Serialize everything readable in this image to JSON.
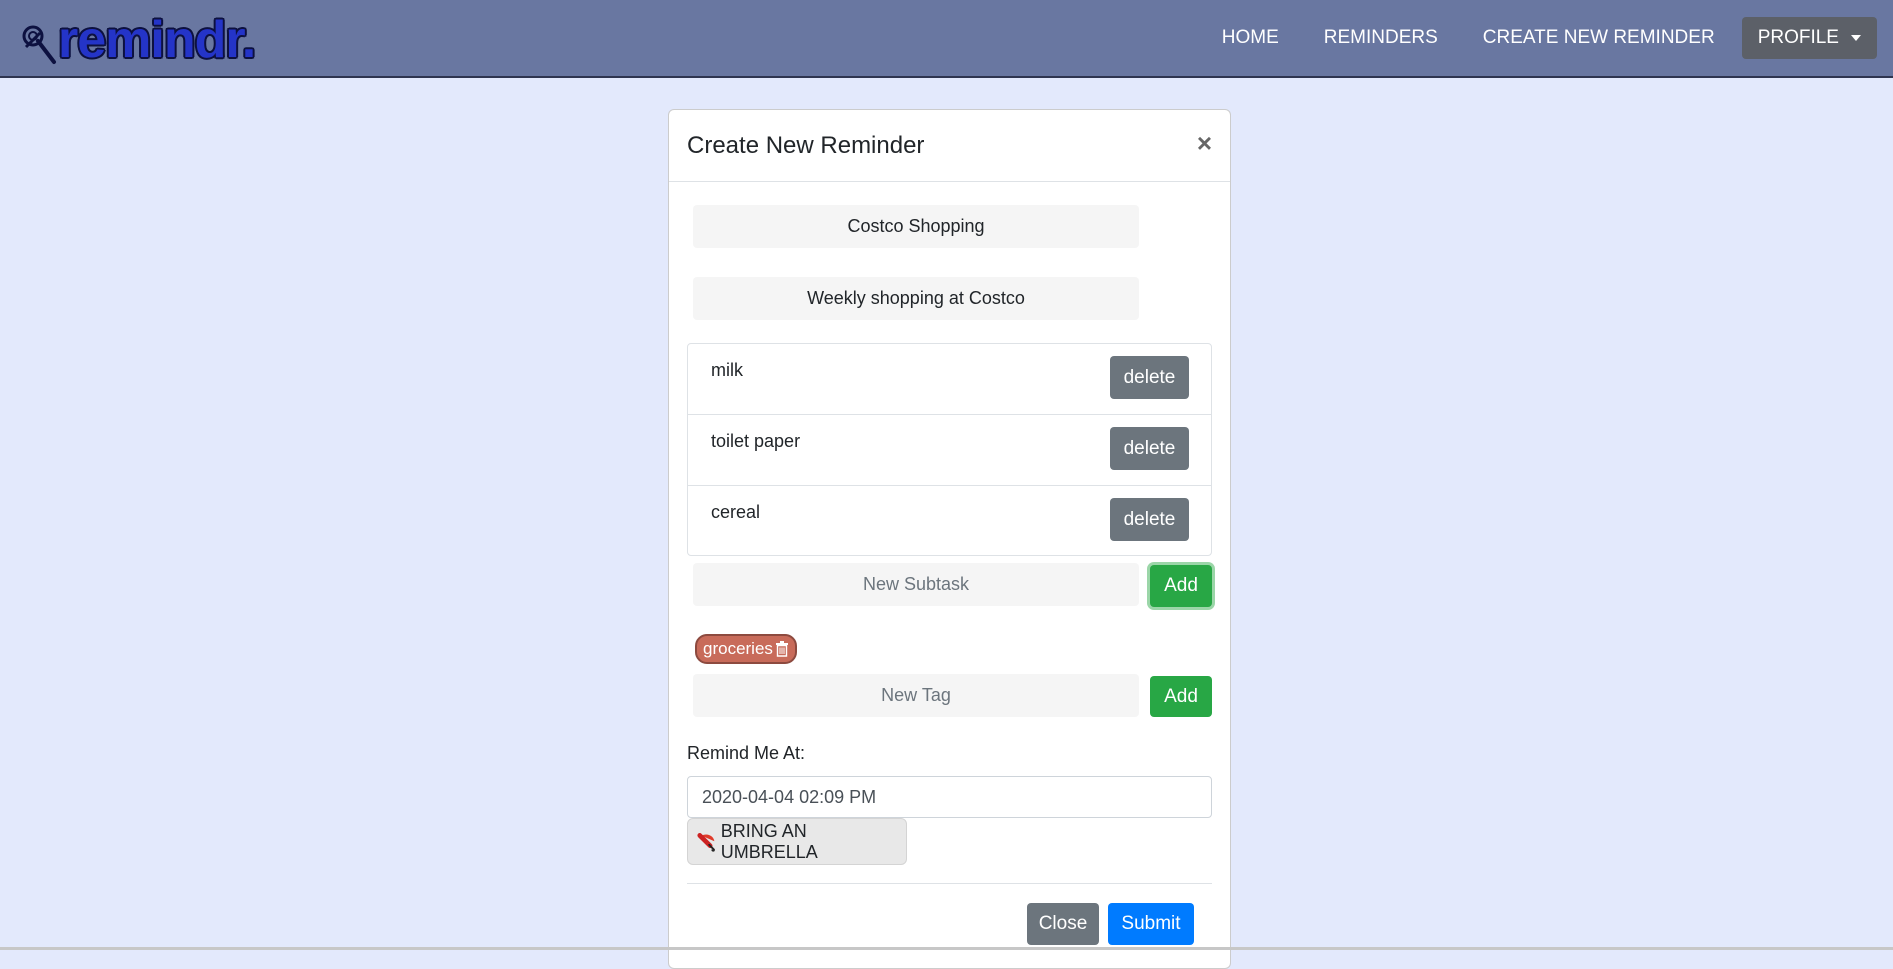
{
  "navbar": {
    "brand": "remindr.",
    "links": [
      "HOME",
      "REMINDERS",
      "CREATE NEW REMINDER"
    ],
    "profile_label": "PROFILE",
    "background": "#6977a1"
  },
  "modal": {
    "title": "Create New Reminder",
    "close_symbol": "×",
    "reminder_title": "Costco Shopping",
    "description": "Weekly shopping at Costco",
    "subtasks": [
      {
        "text": "milk",
        "action": "delete"
      },
      {
        "text": "toilet paper",
        "action": "delete"
      },
      {
        "text": "cereal",
        "action": "delete"
      }
    ],
    "new_subtask_placeholder": "New Subtask",
    "add_label": "Add",
    "tags": [
      "groceries"
    ],
    "new_tag_placeholder": "New Tag",
    "remind_label": "Remind Me At:",
    "remind_value": "2020-04-04 02:09 PM",
    "weather_button": "BRING AN UMBRELLA",
    "close_button": "Close",
    "submit_button": "Submit"
  },
  "icons": {
    "brand": "pushpin-icon",
    "close": "close-icon",
    "tag_delete": "trash-icon",
    "weather": "umbrella-icon",
    "profile": "caret-down-icon"
  },
  "colors": {
    "page_bg": "#e3e9fc",
    "add": "#28a745",
    "delete": "#6c757d",
    "submit": "#007bff",
    "tag": "#c86b5a"
  }
}
